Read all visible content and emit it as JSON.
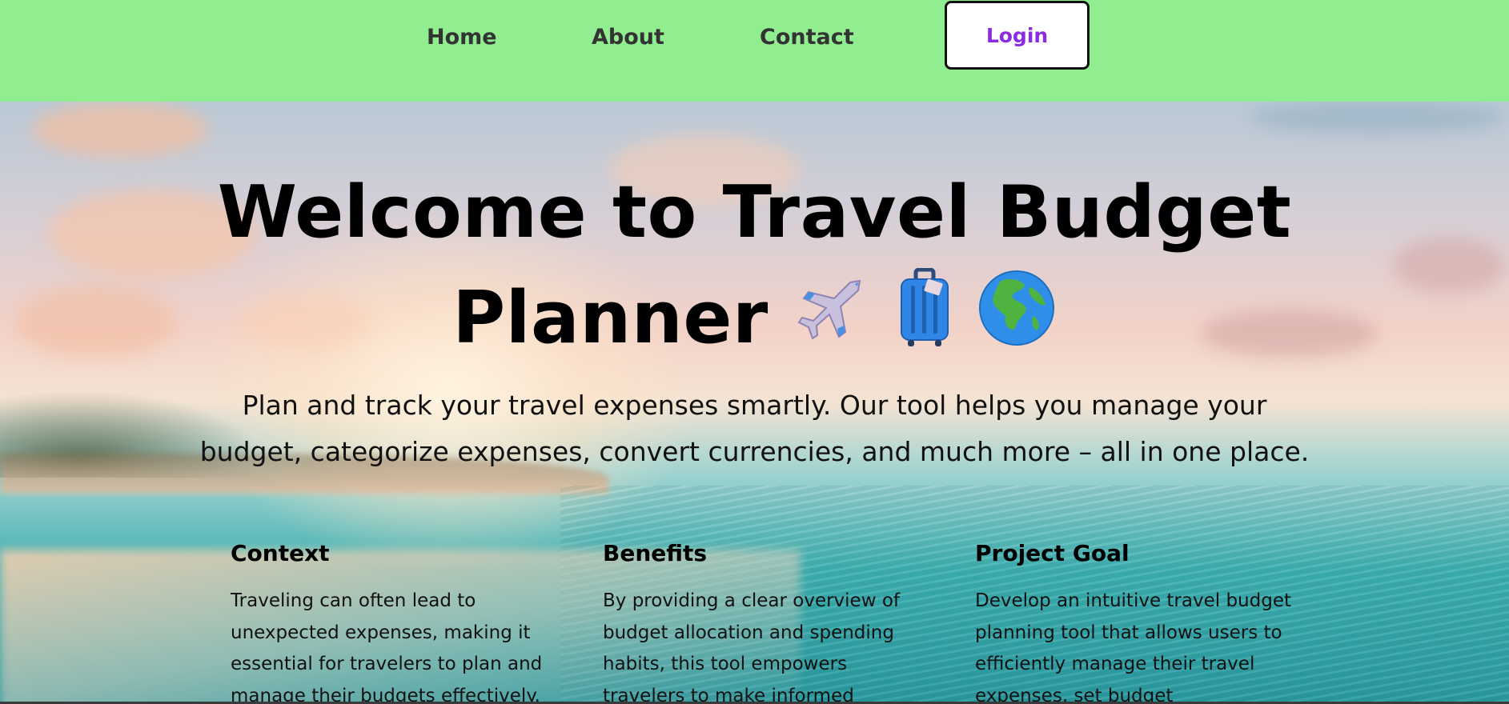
{
  "nav": {
    "home": "Home",
    "about": "About",
    "contact": "Contact",
    "login": "Login"
  },
  "hero": {
    "title": "Welcome to Travel Budget Planner",
    "emojis": [
      "airplane-icon",
      "luggage-icon",
      "globe-icon"
    ],
    "subtitle": "Plan and track your travel expenses smartly. Our tool helps you manage your budget, categorize expenses, convert currencies, and much more – all in one place."
  },
  "sections": [
    {
      "title": "Context",
      "text": "Traveling can often lead to unexpected expenses, making it essential for travelers to plan and manage their budgets effectively."
    },
    {
      "title": "Benefits",
      "text": "By providing a clear overview of budget allocation and spending habits, this tool empowers travelers to make informed"
    },
    {
      "title": "Project Goal",
      "text": "Develop an intuitive travel budget planning tool that allows users to efficiently manage their travel expenses, set budget"
    }
  ],
  "colors": {
    "nav_bg": "#90ee90",
    "nav_text": "#333333",
    "login_text": "#8a2be2"
  }
}
